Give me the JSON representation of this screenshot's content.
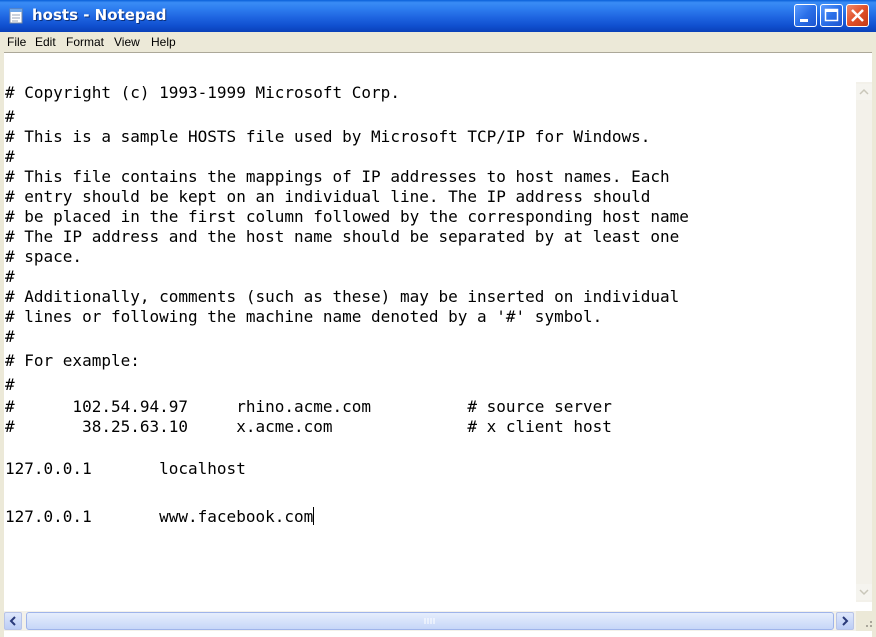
{
  "window": {
    "title": "hosts - Notepad"
  },
  "menu": [
    "File",
    "Edit",
    "Format",
    "View",
    "Help"
  ],
  "editor": {
    "lines": [
      "# Copyright (c) 1993-1999 Microsoft Corp.",
      "#",
      "# This is a sample HOSTS file used by Microsoft TCP/IP for Windows.",
      "#",
      "# This file contains the mappings of IP addresses to host names. Each",
      "# entry should be kept on an individual line. The IP address should",
      "# be placed in the first column followed by the corresponding host name",
      "# The IP address and the host name should be separated by at least one",
      "# space.",
      "#",
      "# Additionally, comments (such as these) may be inserted on individual",
      "# lines or following the machine name denoted by a '#' symbol.",
      "#",
      "# For example:",
      "#",
      "#      102.54.94.97     rhino.acme.com          # source server",
      "#       38.25.63.10     x.acme.com              # x client host",
      "",
      "127.0.0.1       localhost",
      "",
      "127.0.0.1       www.facebook.com"
    ]
  },
  "icons": {
    "app": "notepad-icon",
    "minimize": "minimize-icon",
    "maximize": "maximize-icon",
    "close": "close-icon",
    "scroll_up": "chevron-up-icon",
    "scroll_down": "chevron-down-icon",
    "scroll_left": "chevron-left-icon",
    "scroll_right": "chevron-right-icon"
  },
  "colors": {
    "titlebar": "#1e64e0",
    "close_button": "#e0502a",
    "window_face": "#ece9d8"
  }
}
